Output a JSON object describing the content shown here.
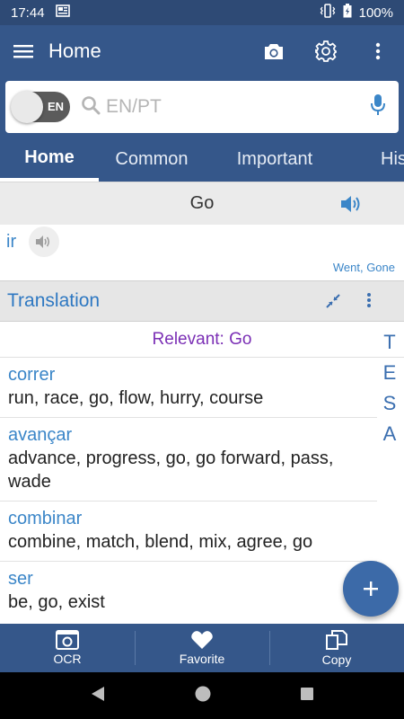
{
  "status_bar": {
    "time": "17:44",
    "battery": "100%"
  },
  "app_bar": {
    "title": "Home"
  },
  "search": {
    "toggle_label": "EN",
    "placeholder": "EN/PT",
    "value": ""
  },
  "tabs": [
    {
      "label": "Home",
      "active": true
    },
    {
      "label": "Common",
      "active": false
    },
    {
      "label": "Important",
      "active": false
    },
    {
      "label": "His",
      "active": false
    }
  ],
  "query": {
    "word": "Go"
  },
  "result": {
    "translation": "ir",
    "forms": "Went, Gone"
  },
  "translation_section": {
    "title": "Translation",
    "relevant": "Relevant: Go",
    "entries": [
      {
        "pt": "correr",
        "en": "run, race, go, flow, hurry, course"
      },
      {
        "pt": "avançar",
        "en": "advance, progress, go, go forward, pass, wade"
      },
      {
        "pt": "combinar",
        "en": "combine, match, blend, mix, agree, go"
      },
      {
        "pt": "ser",
        "en": "be, go, exist"
      }
    ],
    "index_letters": [
      "T",
      "E",
      "S",
      "A"
    ]
  },
  "bottom_bar": {
    "ocr": "OCR",
    "favorite": "Favorite",
    "copy": "Copy"
  },
  "colors": {
    "primary": "#35578a",
    "accent": "#3b86c8",
    "relevant": "#7b2fb5",
    "fab": "#3c6aa8"
  }
}
